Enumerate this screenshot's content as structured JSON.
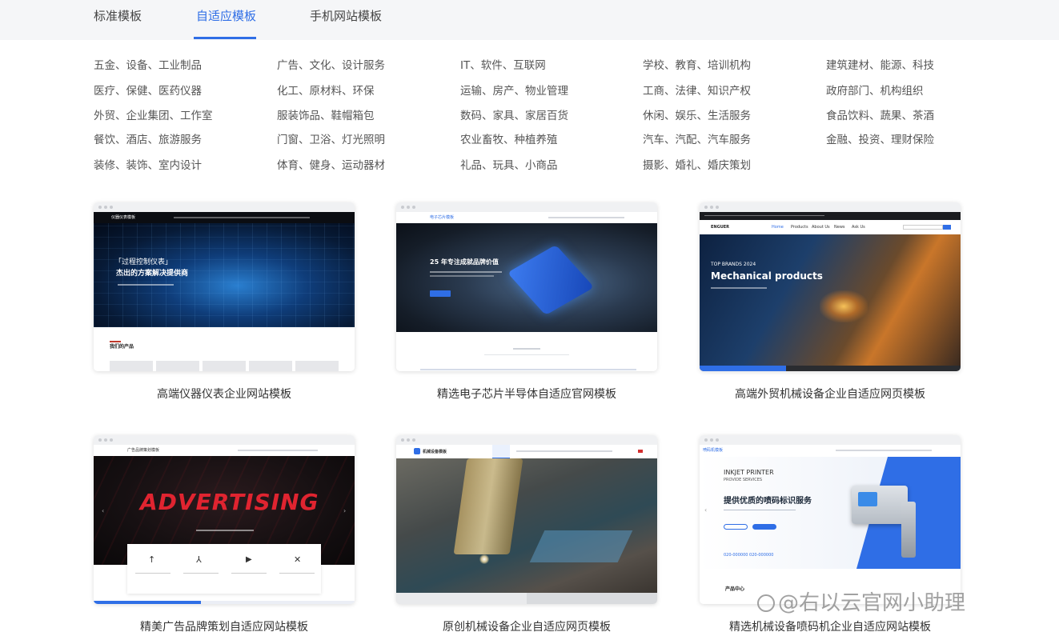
{
  "tabs": [
    {
      "label": "标准模板"
    },
    {
      "label": "自适应模板"
    },
    {
      "label": "手机网站模板"
    }
  ],
  "active_tab": "自适应模板",
  "accent_color": "#2f6ee6",
  "categories": [
    [
      "五金、设备、工业制品",
      "广告、文化、设计服务",
      "IT、软件、互联网",
      "学校、教育、培训机构",
      "建筑建材、能源、科技"
    ],
    [
      "医疗、保健、医药仪器",
      "化工、原材料、环保",
      "运输、房产、物业管理",
      "工商、法律、知识产权",
      "政府部门、机构组织"
    ],
    [
      "外贸、企业集团、工作室",
      "服装饰品、鞋帽箱包",
      "数码、家具、家居百货",
      "休闲、娱乐、生活服务",
      "食品饮料、蔬果、茶酒"
    ],
    [
      "餐饮、酒店、旅游服务",
      "门窗、卫浴、灯光照明",
      "农业畜牧、种植养殖",
      "汽车、汽配、汽车服务",
      "金融、投资、理财保险"
    ],
    [
      "装修、装饰、室内设计",
      "体育、健身、运动器材",
      "礼品、玩具、小商品",
      "摄影、婚礼、婚庆策划",
      ""
    ]
  ],
  "templates": [
    {
      "title": "高端仪器仪表企业网站模板",
      "preview": {
        "logo": "仪器仪表模板",
        "headline_1": "「过程控制仪表」",
        "headline_2": "杰出的方案解决提供商",
        "section_label": "我们的产品"
      }
    },
    {
      "title": "精选电子芯片半导体自适应官网模板",
      "preview": {
        "logo": "电子芯片模板",
        "headline_1": "25 年专注成就品牌价值"
      }
    },
    {
      "title": "高端外贸机械设备企业自适应网页模板",
      "preview": {
        "logo": "ENGUER",
        "nav": [
          "Home",
          "Products",
          "About Us",
          "News",
          "Ask Us"
        ],
        "kicker": "TOP BRANDS 2024",
        "headline_1": "Mechanical products"
      }
    },
    {
      "title": "精美广告品牌策划自适应网站模板",
      "preview": {
        "logo": "广告品牌策划模板",
        "headline_1": "ADVERTISING",
        "feature_icons": [
          "↑",
          "⅄",
          "▶",
          "✕"
        ]
      }
    },
    {
      "title": "原创机械设备企业自适应网页模板",
      "preview": {
        "logo": "机械设备模板"
      }
    },
    {
      "title": "精选机械设备喷码机企业自适应网站模板",
      "preview": {
        "logo": "喷码机模板",
        "kicker": "INKJET PRINTER",
        "sub_kicker": "PROVIDE SERVICES",
        "headline_1": "提供优质的喷码标识服务",
        "phone": "020-000000 020-000000",
        "section_label": "产品中心"
      }
    }
  ],
  "watermark": "@右以云官网小助理"
}
